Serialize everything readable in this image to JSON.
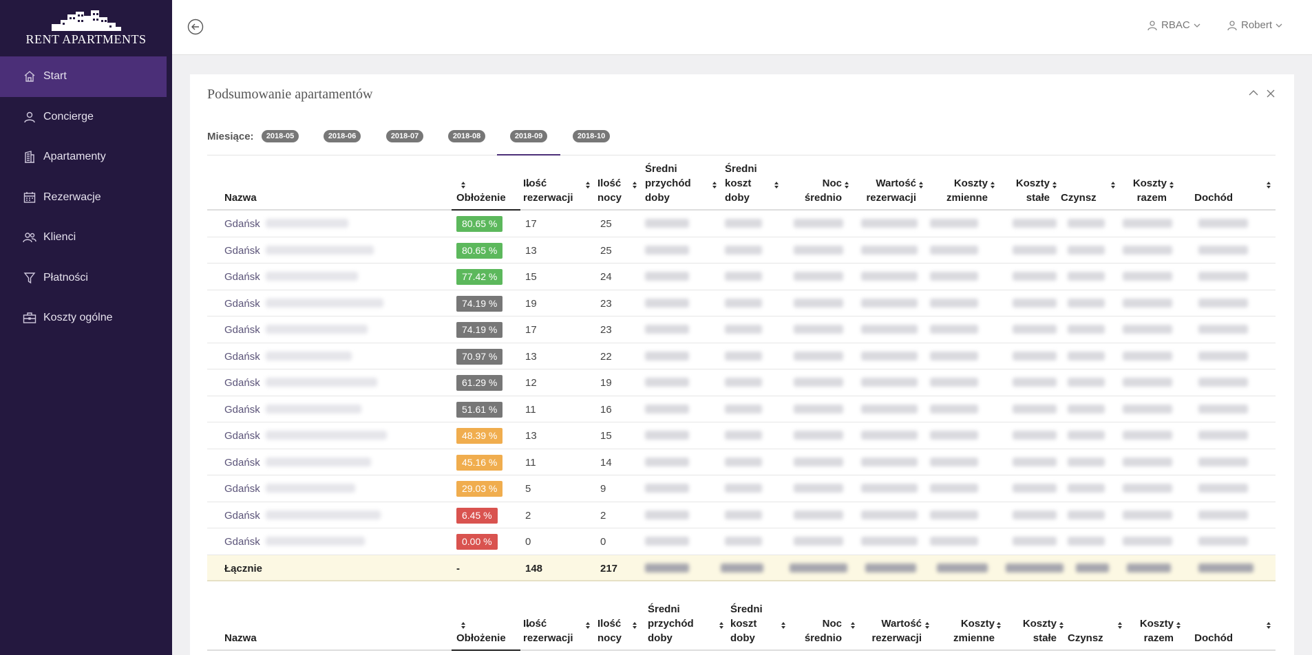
{
  "app": {
    "brand": "RENT APARTMENTS"
  },
  "sidebar": {
    "items": [
      {
        "label": "Start",
        "icon": "home-icon",
        "active": true
      },
      {
        "label": "Concierge",
        "icon": "user-icon"
      },
      {
        "label": "Apartamenty",
        "icon": "building-icon"
      },
      {
        "label": "Rezerwacje",
        "icon": "calendar-icon"
      },
      {
        "label": "Klienci",
        "icon": "users-icon"
      },
      {
        "label": "Płatności",
        "icon": "filter-icon"
      },
      {
        "label": "Koszty ogólne",
        "icon": "briefcase-icon"
      }
    ]
  },
  "header": {
    "menu_rbac": "RBAC",
    "menu_user": "Robert"
  },
  "card": {
    "title": "Podsumowanie apartamentów",
    "months_label": "Miesiące:",
    "months": [
      "2018-05",
      "2018-06",
      "2018-07",
      "2018-08",
      "2018-09",
      "2018-10"
    ],
    "active_month": "2018-09"
  },
  "table": {
    "columns": {
      "nazwa": "Nazwa",
      "oblozenie": "Obłożenie",
      "ilosc_rez_1": "Ilość",
      "ilosc_rez_2": "rezerwacji",
      "ilosc_nocy_1": "Ilość",
      "ilosc_nocy_2": "nocy",
      "sr_przychod_1": "Średni",
      "sr_przychod_2": "przychód",
      "sr_przychod_3": "doby",
      "sr_koszt_1": "Średni",
      "sr_koszt_2": "koszt",
      "sr_koszt_3": "doby",
      "noc_1": "Noc",
      "noc_2": "średnio",
      "wartosc_1": "Wartość",
      "wartosc_2": "rezerwacji",
      "kzm_1": "Koszty",
      "kzm_2": "zmienne",
      "kst_1": "Koszty",
      "kst_2": "stałe",
      "czynsz": "Czynsz",
      "kraz_1": "Koszty",
      "kraz_2": "razem",
      "dochod": "Dochód"
    },
    "rows": [
      {
        "name": "Gdańsk",
        "occupancy": "80.65 %",
        "level": "high",
        "reservations": "17",
        "nights": "25"
      },
      {
        "name": "Gdańsk",
        "occupancy": "80.65 %",
        "level": "high",
        "reservations": "13",
        "nights": "25"
      },
      {
        "name": "Gdańsk",
        "occupancy": "77.42 %",
        "level": "high",
        "reservations": "15",
        "nights": "24"
      },
      {
        "name": "Gdańsk",
        "occupancy": "74.19 %",
        "level": "mid",
        "reservations": "19",
        "nights": "23"
      },
      {
        "name": "Gdańsk",
        "occupancy": "74.19 %",
        "level": "mid",
        "reservations": "17",
        "nights": "23"
      },
      {
        "name": "Gdańsk",
        "occupancy": "70.97 %",
        "level": "mid",
        "reservations": "13",
        "nights": "22"
      },
      {
        "name": "Gdańsk",
        "occupancy": "61.29 %",
        "level": "mid",
        "reservations": "12",
        "nights": "19"
      },
      {
        "name": "Gdańsk",
        "occupancy": "51.61 %",
        "level": "mid",
        "reservations": "11",
        "nights": "16"
      },
      {
        "name": "Gdańsk",
        "occupancy": "48.39 %",
        "level": "warn",
        "reservations": "13",
        "nights": "15"
      },
      {
        "name": "Gdańsk",
        "occupancy": "45.16 %",
        "level": "warn",
        "reservations": "11",
        "nights": "14"
      },
      {
        "name": "Gdańsk",
        "occupancy": "29.03 %",
        "level": "warn",
        "reservations": "5",
        "nights": "9"
      },
      {
        "name": "Gdańsk",
        "occupancy": "6.45 %",
        "level": "low",
        "reservations": "2",
        "nights": "2"
      },
      {
        "name": "Gdańsk",
        "occupancy": "0.00 %",
        "level": "low",
        "reservations": "0",
        "nights": "0"
      }
    ],
    "total": {
      "label": "Łącznie",
      "occupancy": "-",
      "reservations": "148",
      "nights": "217"
    }
  },
  "colors": {
    "high": "#5cb85c",
    "mid": "#777777",
    "warn": "#f0ad4e",
    "low": "#d9534f",
    "sidebar_bg": "#24183f",
    "sidebar_active": "#4b2f78"
  }
}
